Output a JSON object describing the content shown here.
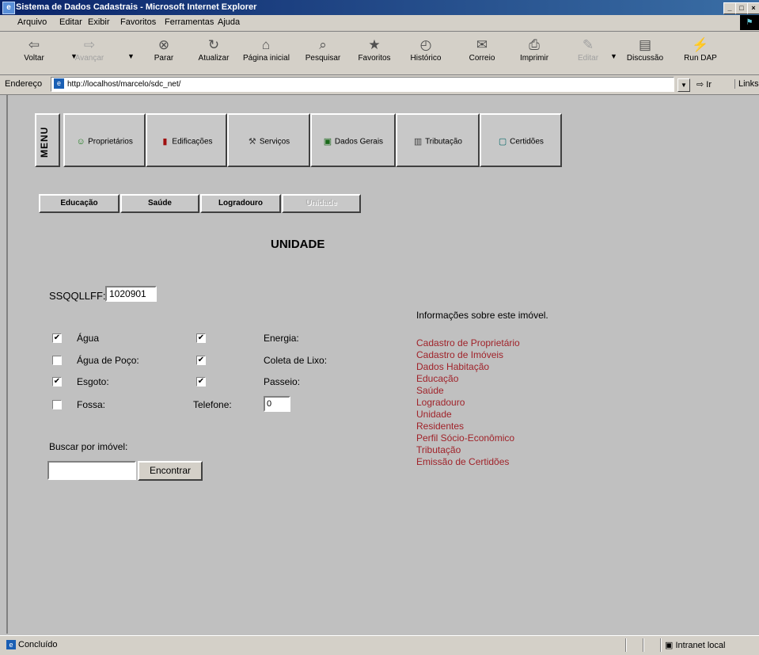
{
  "window": {
    "title": "Sistema de Dados Cadastrais - Microsoft Internet Explorer",
    "controls": [
      "_",
      "□",
      "×"
    ]
  },
  "menubar": [
    "Arquivo",
    "Editar",
    "Exibir",
    "Favoritos",
    "Ferramentas",
    "Ajuda"
  ],
  "toolbar": [
    {
      "label": "Voltar",
      "icon": "back-arrow-icon",
      "glyph": "⇦",
      "enabled": true
    },
    {
      "label": "Avançar",
      "icon": "forward-arrow-icon",
      "glyph": "⇨",
      "enabled": false
    },
    {
      "label": "Parar",
      "icon": "stop-icon",
      "glyph": "⊗",
      "enabled": true
    },
    {
      "label": "Atualizar",
      "icon": "refresh-icon",
      "glyph": "↻",
      "enabled": true
    },
    {
      "label": "Página inicial",
      "icon": "home-icon",
      "glyph": "⌂",
      "enabled": true
    },
    {
      "label": "Pesquisar",
      "icon": "search-icon",
      "glyph": "⌕",
      "enabled": true
    },
    {
      "label": "Favoritos",
      "icon": "favorites-icon",
      "glyph": "★",
      "enabled": true
    },
    {
      "label": "Histórico",
      "icon": "history-icon",
      "glyph": "◴",
      "enabled": true
    },
    {
      "label": "Correio",
      "icon": "mail-icon",
      "glyph": "✉",
      "enabled": true
    },
    {
      "label": "Imprimir",
      "icon": "print-icon",
      "glyph": "⎙",
      "enabled": true
    },
    {
      "label": "Editar",
      "icon": "edit-icon",
      "glyph": "✎",
      "enabled": false
    },
    {
      "label": "Discussão",
      "icon": "discussion-icon",
      "glyph": "▤",
      "enabled": true
    },
    {
      "label": "Run DAP",
      "icon": "dap-icon",
      "glyph": "⚡",
      "enabled": true
    }
  ],
  "address": {
    "label": "Endereço",
    "url": "http://localhost/marcelo/sdc_net/",
    "go": "Ir",
    "links": "Links"
  },
  "nav": {
    "menu_label": "MENU",
    "buttons": [
      {
        "label": "Proprietários",
        "icon": "person-icon",
        "glyph": "☺",
        "color": "#1a7a1a"
      },
      {
        "label": "Edificações",
        "icon": "building-icon",
        "glyph": "▮",
        "color": "#a01010"
      },
      {
        "label": "Serviços",
        "icon": "services-icon",
        "glyph": "⚒",
        "color": "#404040"
      },
      {
        "label": "Dados Gerais",
        "icon": "data-icon",
        "glyph": "▣",
        "color": "#1a6a1a"
      },
      {
        "label": "Tributação",
        "icon": "calculator-icon",
        "glyph": "▥",
        "color": "#404040"
      },
      {
        "label": "Certidões",
        "icon": "certificate-icon",
        "glyph": "▢",
        "color": "#0a6a6a"
      }
    ]
  },
  "subtabs": [
    {
      "label": "Educação",
      "enabled": true
    },
    {
      "label": "Saúde",
      "enabled": true
    },
    {
      "label": "Logradouro",
      "enabled": true
    },
    {
      "label": "Unidade",
      "enabled": false
    }
  ],
  "page": {
    "heading": "UNIDADE",
    "code_label": "SSQQLLFF:",
    "code_value": "1020901"
  },
  "services": [
    {
      "label": "Água",
      "checked": true
    },
    {
      "label": "Água de Poço:",
      "checked": false
    },
    {
      "label": "Esgoto:",
      "checked": true
    },
    {
      "label": "Fossa:",
      "checked": false
    }
  ],
  "services2": [
    {
      "label": "Energia:",
      "checked": true
    },
    {
      "label": "Coleta de Lixo:",
      "checked": true
    },
    {
      "label": "Passeio:",
      "checked": true
    }
  ],
  "telefone": {
    "label": "Telefone:",
    "value": "0"
  },
  "search": {
    "label": "Buscar por imóvel:",
    "button": "Encontrar",
    "value": ""
  },
  "info": {
    "title": "Informações sobre este imóvel.",
    "links": [
      "Cadastro de Proprietário",
      "Cadastro de Imóveis",
      "Dados Habitação",
      "Educação",
      "Saúde",
      "Logradouro",
      "Unidade",
      "Residentes",
      "Perfil Sócio-Econômico",
      "Tributação",
      "Emissão de Certidões"
    ]
  },
  "statusbar": {
    "text": "Concluído",
    "zone": "Intranet local"
  }
}
